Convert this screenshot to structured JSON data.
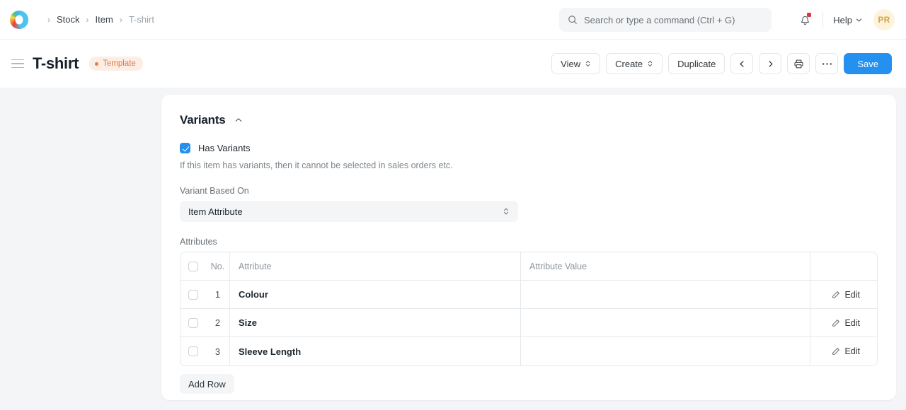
{
  "navbar": {
    "logo_icon": "frappe-logo-icon",
    "breadcrumb": {
      "separator": "›",
      "items": [
        {
          "label": "Stock",
          "current": false
        },
        {
          "label": "Item",
          "current": false
        },
        {
          "label": "T-shirt",
          "current": true
        }
      ]
    },
    "search": {
      "placeholder": "Search or type a command (Ctrl + G)",
      "value": "",
      "icon": "search-icon"
    },
    "notifications": {
      "icon": "bell-icon",
      "has_unread": true
    },
    "help": {
      "label": "Help",
      "icon": "chevron-down-icon"
    },
    "avatar": {
      "initials": "PR",
      "bg": "#fdf3dc",
      "fg": "#d4a441"
    }
  },
  "page_header": {
    "menu_icon": "hamburger-menu-icon",
    "title": "T-shirt",
    "status_badge": {
      "label": "Template",
      "color": "#e8763b",
      "bg": "#fdeee5"
    },
    "toolbar": {
      "view_label": "View",
      "create_label": "Create",
      "duplicate_label": "Duplicate",
      "prev_icon": "chevron-left-icon",
      "next_icon": "chevron-right-icon",
      "print_icon": "printer-icon",
      "more_icon": "ellipsis-icon",
      "save_label": "Save",
      "save_color": "#2490ef"
    }
  },
  "variants_section": {
    "title": "Variants",
    "collapse_icon": "chevron-up-icon",
    "has_variants": {
      "label": "Has Variants",
      "checked": true,
      "help_text": "If this item has variants, then it cannot be selected in sales orders etc."
    },
    "variant_based_on": {
      "label": "Variant Based On",
      "value": "Item Attribute",
      "caret_icon": "chevron-updown-icon"
    },
    "attributes": {
      "label": "Attributes",
      "columns": [
        "No.",
        "Attribute",
        "Attribute Value",
        ""
      ],
      "select_all_checked": false,
      "rows": [
        {
          "no": "1",
          "attribute": "Colour",
          "attribute_value": "",
          "edit_label": "Edit",
          "edit_icon": "pencil-icon",
          "checked": false
        },
        {
          "no": "2",
          "attribute": "Size",
          "attribute_value": "",
          "edit_label": "Edit",
          "edit_icon": "pencil-icon",
          "checked": false
        },
        {
          "no": "3",
          "attribute": "Sleeve Length",
          "attribute_value": "",
          "edit_label": "Edit",
          "edit_icon": "pencil-icon",
          "checked": false
        }
      ],
      "add_row_label": "Add Row"
    }
  }
}
